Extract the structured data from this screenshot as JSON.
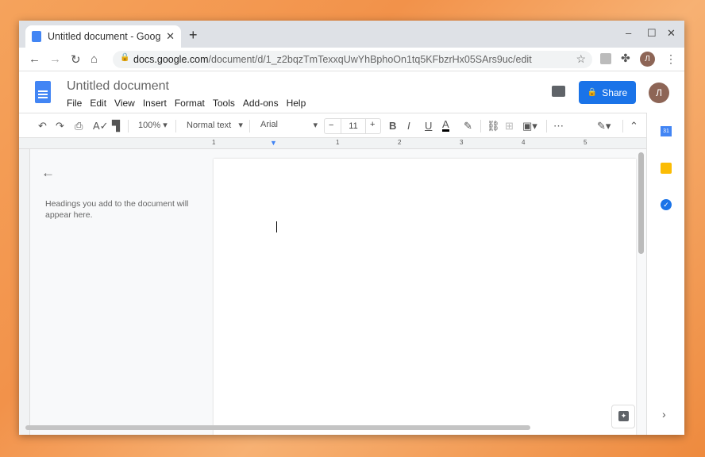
{
  "browser": {
    "tab_title": "Untitled document - Goog",
    "url_domain": "docs.google.com",
    "url_path": "/document/d/1_z2bqzTmTexxqUwYhBphoOn1tq5KFbzrHx05SArs9uc/edit",
    "avatar_letter": "Л"
  },
  "doc": {
    "title": "Untitled document",
    "menu": [
      "File",
      "Edit",
      "View",
      "Insert",
      "Format",
      "Tools",
      "Add-ons",
      "Help"
    ],
    "share_label": "Share",
    "avatar_letter": "Л"
  },
  "toolbar": {
    "zoom": "100%",
    "style": "Normal text",
    "font": "Arial",
    "font_size": "11"
  },
  "ruler": {
    "labels": [
      "1",
      "1",
      "1",
      "2",
      "3",
      "4",
      "5"
    ]
  },
  "outline": {
    "empty_text": "Headings you add to the document will appear here."
  },
  "side": {
    "calendar_label": "31"
  },
  "colors": {
    "accent": "#1a73e8",
    "doc_blue": "#4285f4"
  }
}
